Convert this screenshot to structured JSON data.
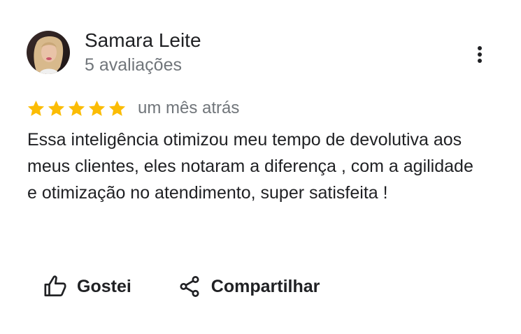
{
  "review": {
    "author": {
      "name": "Samara Leite",
      "review_count": "5 avaliações",
      "avatar": "profile-photo"
    },
    "rating": 5,
    "max_rating": 5,
    "date": "um mês atrás",
    "text": "Essa inteligência otimizou meu tempo de devolutiva aos meus clientes, eles notaram a diferença , com a agilidade e otimização no atendimento, super satisfeita !",
    "actions": {
      "like": {
        "label": "Gostei",
        "icon": "thumbs-up-icon"
      },
      "share": {
        "label": "Compartilhar",
        "icon": "share-icon"
      }
    },
    "menu_icon": "more-vert-icon"
  },
  "colors": {
    "star": "#fbbc04",
    "text_primary": "#202124",
    "text_secondary": "#70757a",
    "background": "#ffffff"
  }
}
